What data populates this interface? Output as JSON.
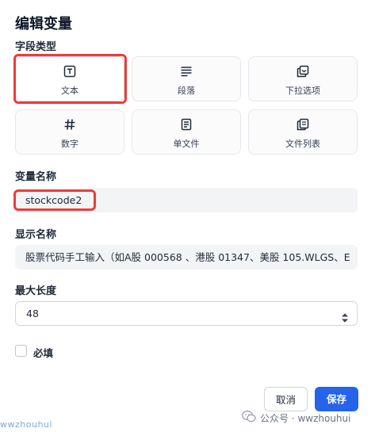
{
  "dialog": {
    "title": "编辑变量"
  },
  "field_type": {
    "label": "字段类型",
    "options": [
      {
        "label": "文本",
        "icon": "text-box-icon",
        "selected": true
      },
      {
        "label": "段落",
        "icon": "paragraph-lines-icon",
        "selected": false
      },
      {
        "label": "下拉选项",
        "icon": "dropdown-options-icon",
        "selected": false
      },
      {
        "label": "数字",
        "icon": "hash-icon",
        "selected": false
      },
      {
        "label": "单文件",
        "icon": "file-icon",
        "selected": false
      },
      {
        "label": "文件列表",
        "icon": "file-list-icon",
        "selected": false
      }
    ]
  },
  "variable_name": {
    "label": "变量名称",
    "value": "stockcode2"
  },
  "display_name": {
    "label": "显示名称",
    "value": "股票代码手工输入（如A股 000568 、港股 01347、美股 105.WLGS、E"
  },
  "max_length": {
    "label": "最大长度",
    "value": "48"
  },
  "required": {
    "label": "必填",
    "checked": false
  },
  "actions": {
    "cancel": "取消",
    "save": "保存"
  },
  "watermark": {
    "left": "wwzhouhui",
    "right": "公众号 · wwzhouhui"
  },
  "colors": {
    "accent": "#2563eb",
    "highlight": "#ef3b3b"
  }
}
